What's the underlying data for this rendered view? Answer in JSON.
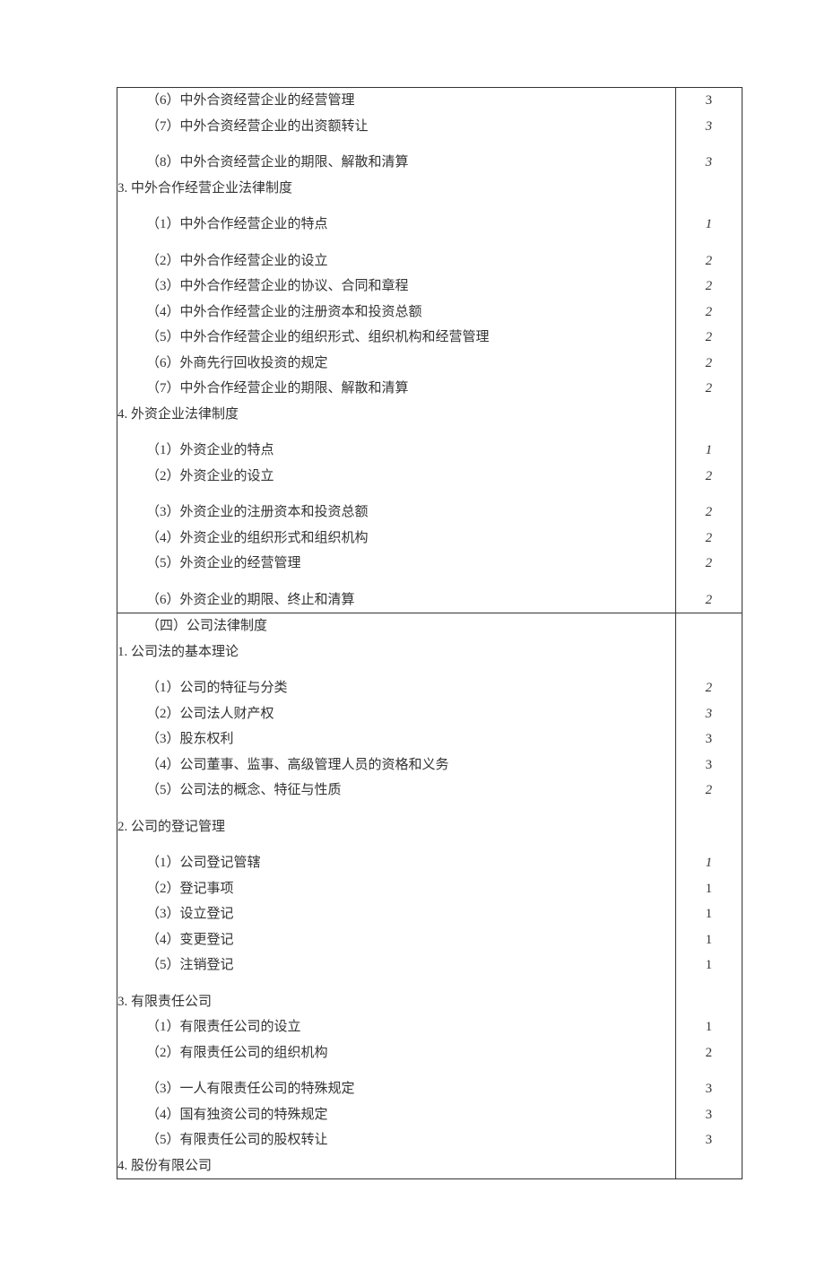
{
  "section1": {
    "rows": [
      {
        "text": "（6）中外合资经营企业的经营管理",
        "indent": "indent-1",
        "value": "3",
        "vstyle": "regular"
      },
      {
        "text": "（7）中外合资经营企业的出资额转让",
        "indent": "indent-1",
        "value": "3",
        "vstyle": "italic"
      },
      {
        "text": "",
        "indent": "indent-1",
        "spacer": true
      },
      {
        "text": "（8）中外合资经营企业的期限、解散和清算",
        "indent": "indent-1",
        "value": "3",
        "vstyle": "italic"
      },
      {
        "text": "3. 中外合作经营企业法律制度",
        "indent": "indent-0",
        "value": "",
        "vstyle": "regular"
      },
      {
        "text": "",
        "indent": "indent-1",
        "spacer": true
      },
      {
        "text": "（1）中外合作经营企业的特点",
        "indent": "indent-1",
        "value": "1",
        "vstyle": "italic"
      },
      {
        "text": "",
        "indent": "indent-1",
        "spacer": true
      },
      {
        "text": "（2）中外合作经营企业的设立",
        "indent": "indent-1",
        "value": "2",
        "vstyle": "italic"
      },
      {
        "text": "（3）中外合作经营企业的协议、合同和章程",
        "indent": "indent-1",
        "value": "2",
        "vstyle": "italic"
      },
      {
        "text": "（4）中外合作经营企业的注册资本和投资总额",
        "indent": "indent-1",
        "value": "2",
        "vstyle": "italic"
      },
      {
        "text": "（5）中外合作经营企业的组织形式、组织机构和经营管理",
        "indent": "indent-1",
        "value": "2",
        "vstyle": "italic"
      },
      {
        "text": "（6）外商先行回收投资的规定",
        "indent": "indent-1",
        "value": "2",
        "vstyle": "italic"
      },
      {
        "text": "（7）中外合作经营企业的期限、解散和清算",
        "indent": "indent-1",
        "value": "2",
        "vstyle": "italic"
      },
      {
        "text": "4. 外资企业法律制度",
        "indent": "indent-0",
        "value": "",
        "vstyle": "regular"
      },
      {
        "text": "",
        "indent": "indent-1",
        "spacer": true
      },
      {
        "text": "（1）外资企业的特点",
        "indent": "indent-1",
        "value": "1",
        "vstyle": "italic"
      },
      {
        "text": "（2）外资企业的设立",
        "indent": "indent-1",
        "value": "2",
        "vstyle": "italic"
      },
      {
        "text": "",
        "indent": "indent-1",
        "spacer": true
      },
      {
        "text": "（3）外资企业的注册资本和投资总额",
        "indent": "indent-1",
        "value": "2",
        "vstyle": "italic"
      },
      {
        "text": "（4）外资企业的组织形式和组织机构",
        "indent": "indent-1",
        "value": "2",
        "vstyle": "italic"
      },
      {
        "text": "（5）外资企业的经营管理",
        "indent": "indent-1",
        "value": "2",
        "vstyle": "italic"
      },
      {
        "text": "",
        "indent": "indent-1",
        "spacer": true
      },
      {
        "text": "（6）外资企业的期限、终止和清算",
        "indent": "indent-1",
        "value": "2",
        "vstyle": "italic"
      }
    ]
  },
  "section2": {
    "rows": [
      {
        "text": "（四）公司法律制度",
        "indent": "indent-1",
        "value": "",
        "vstyle": "regular"
      },
      {
        "text": "1. 公司法的基本理论",
        "indent": "indent-0",
        "value": "",
        "vstyle": "regular"
      },
      {
        "text": "",
        "indent": "indent-1",
        "spacer": true
      },
      {
        "text": "（1）公司的特征与分类",
        "indent": "indent-1",
        "value": "2",
        "vstyle": "italic"
      },
      {
        "text": "（2）公司法人财产权",
        "indent": "indent-1",
        "value": "3",
        "vstyle": "italic"
      },
      {
        "text": "（3）股东权利",
        "indent": "indent-1",
        "value": "3",
        "vstyle": "regular"
      },
      {
        "text": "（4）公司董事、监事、高级管理人员的资格和义务",
        "indent": "indent-1",
        "value": "3",
        "vstyle": "regular"
      },
      {
        "text": "（5）公司法的概念、特征与性质",
        "indent": "indent-1",
        "value": "2",
        "vstyle": "italic"
      },
      {
        "text": "",
        "indent": "indent-1",
        "spacer": true
      },
      {
        "text": "2. 公司的登记管理",
        "indent": "indent-0",
        "value": "",
        "vstyle": "regular"
      },
      {
        "text": "",
        "indent": "indent-1",
        "spacer": true
      },
      {
        "text": "（1）公司登记管辖",
        "indent": "indent-1",
        "value": "1",
        "vstyle": "italic"
      },
      {
        "text": "（2）登记事项",
        "indent": "indent-1",
        "value": "1",
        "vstyle": "regular"
      },
      {
        "text": "（3）设立登记",
        "indent": "indent-1",
        "value": "1",
        "vstyle": "regular"
      },
      {
        "text": "（4）变更登记",
        "indent": "indent-1",
        "value": "1",
        "vstyle": "regular"
      },
      {
        "text": "（5）注销登记",
        "indent": "indent-1",
        "value": "1",
        "vstyle": "regular"
      },
      {
        "text": "",
        "indent": "indent-1",
        "spacer": true
      },
      {
        "text": "3. 有限责任公司",
        "indent": "indent-0",
        "value": "",
        "vstyle": "regular"
      },
      {
        "text": "（1）有限责任公司的设立",
        "indent": "indent-1",
        "value": "1",
        "vstyle": "regular"
      },
      {
        "text": "（2）有限责任公司的组织机构",
        "indent": "indent-1",
        "value": "2",
        "vstyle": "regular"
      },
      {
        "text": "",
        "indent": "indent-1",
        "spacer": true
      },
      {
        "text": "（3）一人有限责任公司的特殊规定",
        "indent": "indent-1",
        "value": "3",
        "vstyle": "regular"
      },
      {
        "text": "（4）国有独资公司的特殊规定",
        "indent": "indent-1",
        "value": "3",
        "vstyle": "regular"
      },
      {
        "text": "（5）有限责任公司的股权转让",
        "indent": "indent-1",
        "value": "3",
        "vstyle": "regular"
      },
      {
        "text": "4. 股份有限公司",
        "indent": "indent-0",
        "value": "",
        "vstyle": "regular"
      }
    ]
  }
}
